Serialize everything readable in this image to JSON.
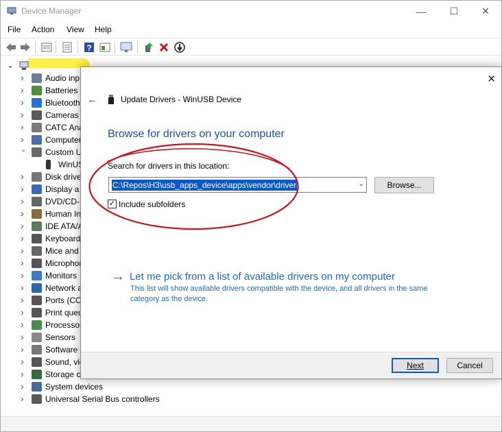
{
  "window": {
    "title": "Device Manager",
    "controls": {
      "minimize": "—",
      "maximize": "☐",
      "close": "✕"
    }
  },
  "menu": [
    "File",
    "Action",
    "View",
    "Help"
  ],
  "toolbar": {
    "icons": [
      "back-icon",
      "forward-icon",
      "properties-icon",
      "computer-list-icon",
      "help-icon",
      "view-icon",
      "monitor-icon",
      "update-driver-icon",
      "uninstall-icon",
      "disable-icon"
    ]
  },
  "tree": {
    "root_chevron": "⌄",
    "items": [
      {
        "label": "Audio inp",
        "expanded": false,
        "icon": "audio-icon"
      },
      {
        "label": "Batteries",
        "expanded": false,
        "icon": "battery-icon"
      },
      {
        "label": "Bluetooth",
        "expanded": false,
        "icon": "bluetooth-icon"
      },
      {
        "label": "Cameras",
        "expanded": false,
        "icon": "camera-icon"
      },
      {
        "label": "CATC Ana",
        "expanded": false,
        "icon": "catc-icon"
      },
      {
        "label": "Computer",
        "expanded": false,
        "icon": "computer-icon"
      },
      {
        "label": "Custom U",
        "expanded": true,
        "icon": "usb-icon"
      },
      {
        "label": "WinUSB",
        "child": true,
        "icon": "usb-plug-icon"
      },
      {
        "label": "Disk drive",
        "expanded": false,
        "icon": "disk-icon"
      },
      {
        "label": "Display a",
        "expanded": false,
        "icon": "display-icon"
      },
      {
        "label": "DVD/CD-R",
        "expanded": false,
        "icon": "dvd-icon"
      },
      {
        "label": "Human In",
        "expanded": false,
        "icon": "hid-icon"
      },
      {
        "label": "IDE ATA/A",
        "expanded": false,
        "icon": "ide-icon"
      },
      {
        "label": "Keyboards",
        "expanded": false,
        "icon": "keyboard-icon"
      },
      {
        "label": "Mice and",
        "expanded": false,
        "icon": "mouse-icon"
      },
      {
        "label": "Microphon",
        "expanded": false,
        "icon": "microphone-icon"
      },
      {
        "label": "Monitors",
        "expanded": false,
        "icon": "monitor-icon"
      },
      {
        "label": "Network a",
        "expanded": false,
        "icon": "network-icon"
      },
      {
        "label": "Ports (CO",
        "expanded": false,
        "icon": "ports-icon"
      },
      {
        "label": "Print queu",
        "expanded": false,
        "icon": "printer-icon"
      },
      {
        "label": "Processor",
        "expanded": false,
        "icon": "processor-icon"
      },
      {
        "label": "Sensors",
        "expanded": false,
        "icon": "sensor-icon"
      },
      {
        "label": "Software c",
        "expanded": false,
        "icon": "software-icon"
      },
      {
        "label": "Sound, vid",
        "expanded": false,
        "icon": "sound-icon"
      },
      {
        "label": "Storage co",
        "expanded": false,
        "icon": "storage-icon"
      },
      {
        "label": "System devices",
        "expanded": false,
        "icon": "system-icon"
      },
      {
        "label": "Universal Serial Bus controllers",
        "expanded": false,
        "icon": "usb-controller-icon"
      }
    ]
  },
  "dialog": {
    "title": "Update Drivers - WinUSB Device",
    "close": "✕",
    "back": "←",
    "heading": "Browse for drivers on your computer",
    "search_label": "Search for drivers in this location:",
    "path_value": "C:\\Repos\\H3\\usb_apps_device\\apps\\vendor\\driver",
    "browse_label": "Browse...",
    "include_subfolders_label": "Include subfolders",
    "include_subfolders_checked": true,
    "checkmark": "✓",
    "pick_arrow": "→",
    "pick_title": "Let me pick from a list of available drivers on my computer",
    "pick_description": "This list will show available drivers compatible with the device, and all drivers in the same category as the device.",
    "next_label": "Next",
    "cancel_label": "Cancel"
  },
  "colors": {
    "link_blue": "#1b6ad0",
    "heading_blue": "#1b4fb0",
    "selection_blue": "#0a59c9",
    "annotation_red": "#d0121b",
    "highlight_yellow": "#ffef3a"
  }
}
